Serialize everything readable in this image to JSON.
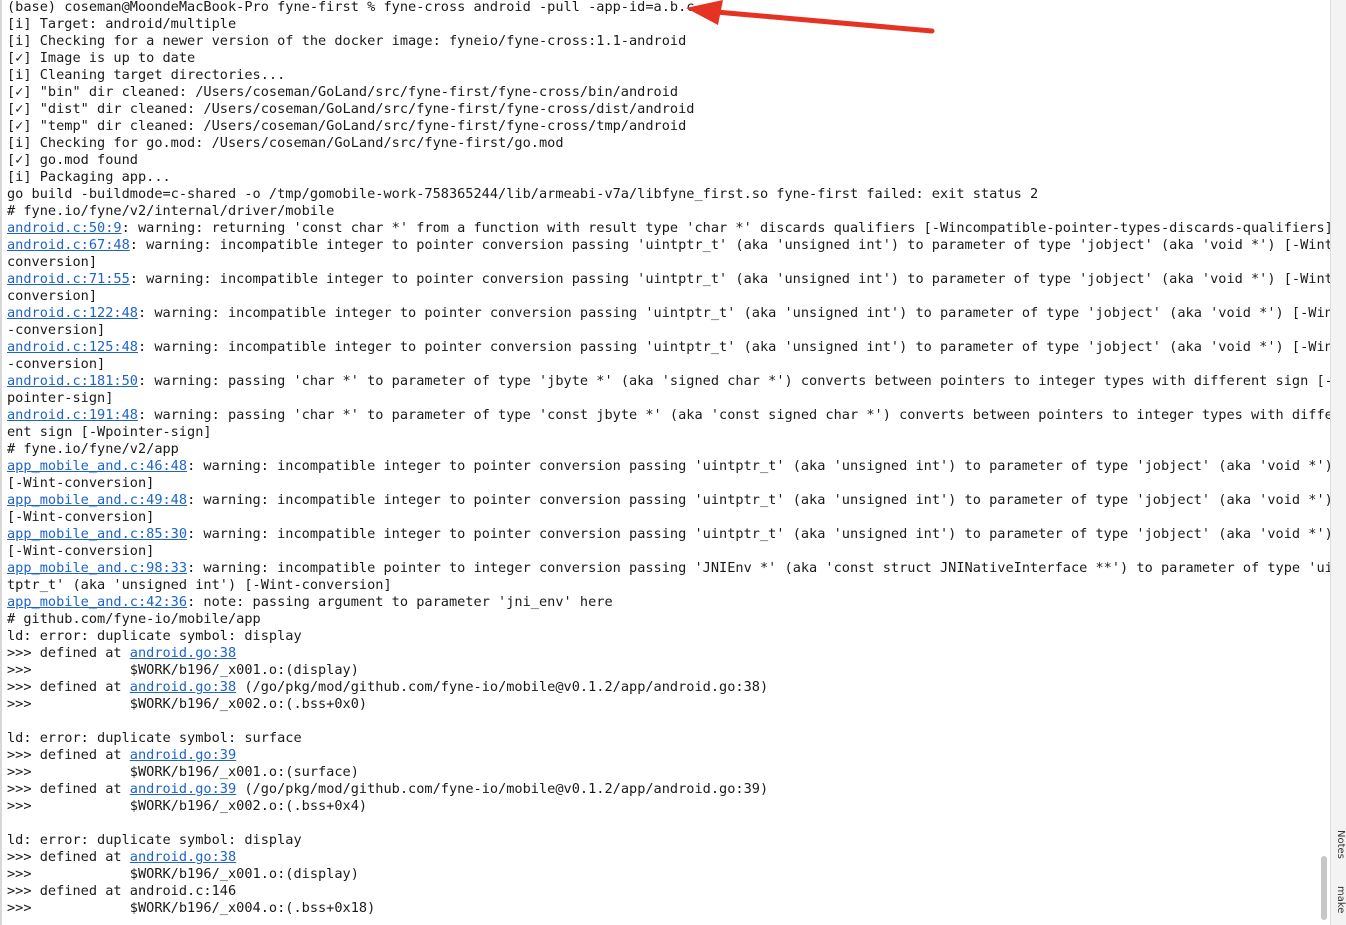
{
  "terminal": {
    "lines": [
      [
        {
          "t": "(base) coseman@MoondeMacBook-Pro fyne-first % fyne-cross android -pull -app-id=a.b.c"
        }
      ],
      [
        {
          "t": "[i] Target: android/multiple"
        }
      ],
      [
        {
          "t": "[i] Checking for a newer version of the docker image: fyneio/fyne-cross:1.1-android"
        }
      ],
      [
        {
          "t": "[✓] Image is up to date"
        }
      ],
      [
        {
          "t": "[i] Cleaning target directories..."
        }
      ],
      [
        {
          "t": "[✓] \"bin\" dir cleaned: /Users/coseman/GoLand/src/fyne-first/fyne-cross/bin/android"
        }
      ],
      [
        {
          "t": "[✓] \"dist\" dir cleaned: /Users/coseman/GoLand/src/fyne-first/fyne-cross/dist/android"
        }
      ],
      [
        {
          "t": "[✓] \"temp\" dir cleaned: /Users/coseman/GoLand/src/fyne-first/fyne-cross/tmp/android"
        }
      ],
      [
        {
          "t": "[i] Checking for go.mod: /Users/coseman/GoLand/src/fyne-first/go.mod"
        }
      ],
      [
        {
          "t": "[✓] go.mod found"
        }
      ],
      [
        {
          "t": "[i] Packaging app..."
        }
      ],
      [
        {
          "t": "go build -buildmode=c-shared -o /tmp/gomobile-work-758365244/lib/armeabi-v7a/libfyne_first.so fyne-first failed: exit status 2"
        }
      ],
      [
        {
          "t": "# fyne.io/fyne/v2/internal/driver/mobile"
        }
      ],
      [
        {
          "t": "android.c:50:9",
          "link": true
        },
        {
          "t": ": warning: returning 'const char *' from a function with result type 'char *' discards qualifiers [-Wincompatible-pointer-types-discards-qualifiers]"
        }
      ],
      [
        {
          "t": "android.c:67:48",
          "link": true
        },
        {
          "t": ": warning: incompatible integer to pointer conversion passing 'uintptr_t' (aka 'unsigned int') to parameter of type 'jobject' (aka 'void *') [-Wint-"
        }
      ],
      [
        {
          "t": "conversion]"
        }
      ],
      [
        {
          "t": "android.c:71:55",
          "link": true
        },
        {
          "t": ": warning: incompatible integer to pointer conversion passing 'uintptr_t' (aka 'unsigned int') to parameter of type 'jobject' (aka 'void *') [-Wint-"
        }
      ],
      [
        {
          "t": "conversion]"
        }
      ],
      [
        {
          "t": "android.c:122:48",
          "link": true
        },
        {
          "t": ": warning: incompatible integer to pointer conversion passing 'uintptr_t' (aka 'unsigned int') to parameter of type 'jobject' (aka 'void *') [-Wint"
        }
      ],
      [
        {
          "t": "-conversion]"
        }
      ],
      [
        {
          "t": "android.c:125:48",
          "link": true
        },
        {
          "t": ": warning: incompatible integer to pointer conversion passing 'uintptr_t' (aka 'unsigned int') to parameter of type 'jobject' (aka 'void *') [-Wint"
        }
      ],
      [
        {
          "t": "-conversion]"
        }
      ],
      [
        {
          "t": "android.c:181:50",
          "link": true
        },
        {
          "t": ": warning: passing 'char *' to parameter of type 'jbyte *' (aka 'signed char *') converts between pointers to integer types with different sign [-W"
        }
      ],
      [
        {
          "t": "pointer-sign]"
        }
      ],
      [
        {
          "t": "android.c:191:48",
          "link": true
        },
        {
          "t": ": warning: passing 'char *' to parameter of type 'const jbyte *' (aka 'const signed char *') converts between pointers to integer types with differ"
        }
      ],
      [
        {
          "t": "ent sign [-Wpointer-sign]"
        }
      ],
      [
        {
          "t": "# fyne.io/fyne/v2/app"
        }
      ],
      [
        {
          "t": "app_mobile_and.c:46:48",
          "link": true
        },
        {
          "t": ": warning: incompatible integer to pointer conversion passing 'uintptr_t' (aka 'unsigned int') to parameter of type 'jobject' (aka 'void *')"
        }
      ],
      [
        {
          "t": "[-Wint-conversion]"
        }
      ],
      [
        {
          "t": "app_mobile_and.c:49:48",
          "link": true
        },
        {
          "t": ": warning: incompatible integer to pointer conversion passing 'uintptr_t' (aka 'unsigned int') to parameter of type 'jobject' (aka 'void *')"
        }
      ],
      [
        {
          "t": "[-Wint-conversion]"
        }
      ],
      [
        {
          "t": "app_mobile_and.c:85:30",
          "link": true
        },
        {
          "t": ": warning: incompatible integer to pointer conversion passing 'uintptr_t' (aka 'unsigned int') to parameter of type 'jobject' (aka 'void *')"
        }
      ],
      [
        {
          "t": "[-Wint-conversion]"
        }
      ],
      [
        {
          "t": "app_mobile_and.c:98:33",
          "link": true
        },
        {
          "t": ": warning: incompatible pointer to integer conversion passing 'JNIEnv *' (aka 'const struct JNINativeInterface **') to parameter of type 'uin"
        }
      ],
      [
        {
          "t": "tptr_t' (aka 'unsigned int') [-Wint-conversion]"
        }
      ],
      [
        {
          "t": "app_mobile_and.c:42:36",
          "link": true
        },
        {
          "t": ": note: passing argument to parameter 'jni_env' here"
        }
      ],
      [
        {
          "t": "# github.com/fyne-io/mobile/app"
        }
      ],
      [
        {
          "t": "ld: error: duplicate symbol: display"
        }
      ],
      [
        {
          "t": ">>> defined at "
        },
        {
          "t": "android.go:38",
          "link": true
        }
      ],
      [
        {
          "t": ">>>            $WORK/b196/_x001.o:(display)"
        }
      ],
      [
        {
          "t": ">>> defined at "
        },
        {
          "t": "android.go:38",
          "link": true
        },
        {
          "t": " (/go/pkg/mod/github.com/fyne-io/mobile@v0.1.2/app/android.go:38)"
        }
      ],
      [
        {
          "t": ">>>            $WORK/b196/_x002.o:(.bss+0x0)"
        }
      ],
      [
        {
          "t": ""
        }
      ],
      [
        {
          "t": "ld: error: duplicate symbol: surface"
        }
      ],
      [
        {
          "t": ">>> defined at "
        },
        {
          "t": "android.go:39",
          "link": true
        }
      ],
      [
        {
          "t": ">>>            $WORK/b196/_x001.o:(surface)"
        }
      ],
      [
        {
          "t": ">>> defined at "
        },
        {
          "t": "android.go:39",
          "link": true
        },
        {
          "t": " (/go/pkg/mod/github.com/fyne-io/mobile@v0.1.2/app/android.go:39)"
        }
      ],
      [
        {
          "t": ">>>            $WORK/b196/_x002.o:(.bss+0x4)"
        }
      ],
      [
        {
          "t": ""
        }
      ],
      [
        {
          "t": "ld: error: duplicate symbol: display"
        }
      ],
      [
        {
          "t": ">>> defined at "
        },
        {
          "t": "android.go:38",
          "link": true
        }
      ],
      [
        {
          "t": ">>>            $WORK/b196/_x001.o:(display)"
        }
      ],
      [
        {
          "t": ">>> defined at android.c:146"
        }
      ],
      [
        {
          "t": ">>>            $WORK/b196/_x004.o:(.bss+0x18)"
        }
      ]
    ]
  },
  "side_panel": {
    "notes_label": "Notes",
    "make_label": "make"
  },
  "colors": {
    "text": "#1a1a1a",
    "link": "#1d63c9",
    "arrow": "#e53223",
    "background": "#ffffff"
  },
  "icons": {
    "annotation": "red-arrow-icon"
  }
}
